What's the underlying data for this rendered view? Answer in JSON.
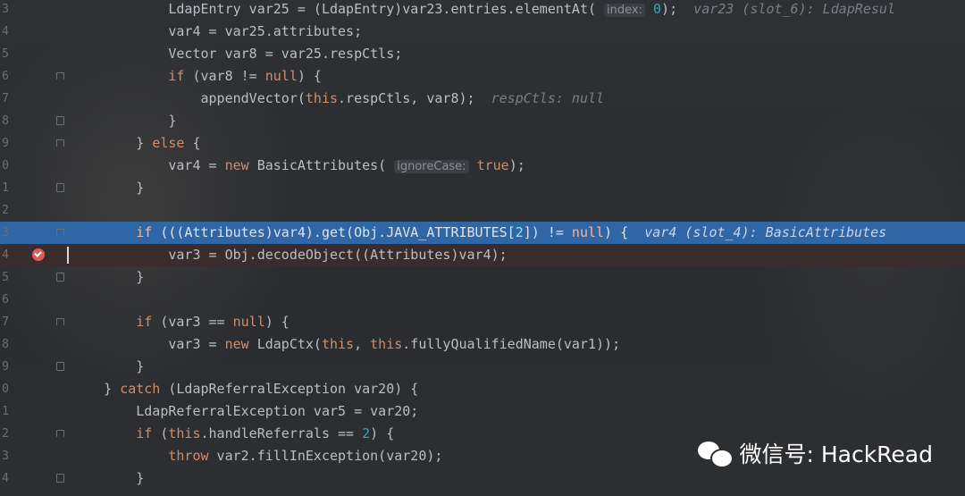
{
  "editor": {
    "lines": [
      {
        "num": "3",
        "tokens": [
          {
            "t": "            LdapEntry var25 = (LdapEntry)var23.entries.elementAt( "
          },
          {
            "t": "index:",
            "c": "hint"
          },
          {
            "t": " "
          },
          {
            "t": "0",
            "c": "num"
          },
          {
            "t": ");  "
          },
          {
            "t": "var23 (slot_6): LdapResul",
            "c": "inlineval"
          }
        ],
        "fold": false
      },
      {
        "num": "4",
        "tokens": [
          {
            "t": "            var4 = var25.attributes;"
          }
        ],
        "fold": false
      },
      {
        "num": "5",
        "tokens": [
          {
            "t": "            Vector var8 = var25.respCtls;"
          }
        ],
        "fold": false
      },
      {
        "num": "6",
        "tokens": [
          {
            "t": "            "
          },
          {
            "t": "if",
            "c": "kw"
          },
          {
            "t": " (var8 != "
          },
          {
            "t": "null",
            "c": "kw"
          },
          {
            "t": ") {"
          }
        ],
        "fold": "open"
      },
      {
        "num": "7",
        "tokens": [
          {
            "t": "                appendVector("
          },
          {
            "t": "this",
            "c": "kw"
          },
          {
            "t": ".respCtls, var8);  "
          },
          {
            "t": "respCtls: null",
            "c": "inlineval"
          }
        ],
        "fold": false
      },
      {
        "num": "8",
        "tokens": [
          {
            "t": "            }"
          }
        ],
        "fold": "close"
      },
      {
        "num": "9",
        "tokens": [
          {
            "t": "        } "
          },
          {
            "t": "else",
            "c": "kw"
          },
          {
            "t": " {"
          }
        ],
        "fold": "open"
      },
      {
        "num": "0",
        "tokens": [
          {
            "t": "            var4 = "
          },
          {
            "t": "new",
            "c": "kw"
          },
          {
            "t": " BasicAttributes( "
          },
          {
            "t": "ignoreCase:",
            "c": "hint"
          },
          {
            "t": " "
          },
          {
            "t": "true",
            "c": "kw"
          },
          {
            "t": ");"
          }
        ],
        "fold": false
      },
      {
        "num": "1",
        "tokens": [
          {
            "t": "        }"
          }
        ],
        "fold": "close"
      },
      {
        "num": "2",
        "tokens": [
          {
            "t": ""
          }
        ],
        "fold": false
      },
      {
        "num": "3",
        "tokens": [
          {
            "t": "        "
          },
          {
            "t": "if",
            "c": "kw"
          },
          {
            "t": " (((Attributes)var4).get(Obj.JAVA_ATTRIBUTES["
          },
          {
            "t": "2",
            "c": "num"
          },
          {
            "t": "]) != "
          },
          {
            "t": "null",
            "c": "kw"
          },
          {
            "t": ") {  "
          },
          {
            "t": "var4 (slot_4): BasicAttributes",
            "c": "inlineval"
          }
        ],
        "fold": "open",
        "state": "highlight"
      },
      {
        "num": "4",
        "tokens": [
          {
            "t": "            var3 = Obj.decodeObject((Attributes)var4);"
          }
        ],
        "fold": false,
        "state": "breakpoint"
      },
      {
        "num": "5",
        "tokens": [
          {
            "t": "        }"
          }
        ],
        "fold": "close"
      },
      {
        "num": "6",
        "tokens": [
          {
            "t": ""
          }
        ],
        "fold": false
      },
      {
        "num": "7",
        "tokens": [
          {
            "t": "        "
          },
          {
            "t": "if",
            "c": "kw"
          },
          {
            "t": " (var3 == "
          },
          {
            "t": "null",
            "c": "kw"
          },
          {
            "t": ") {"
          }
        ],
        "fold": "open"
      },
      {
        "num": "8",
        "tokens": [
          {
            "t": "            var3 = "
          },
          {
            "t": "new",
            "c": "kw"
          },
          {
            "t": " LdapCtx("
          },
          {
            "t": "this",
            "c": "kw"
          },
          {
            "t": ", "
          },
          {
            "t": "this",
            "c": "kw"
          },
          {
            "t": ".fullyQualifiedName(var1));"
          }
        ],
        "fold": false
      },
      {
        "num": "9",
        "tokens": [
          {
            "t": "        }"
          }
        ],
        "fold": "close"
      },
      {
        "num": "0",
        "tokens": [
          {
            "t": "    } "
          },
          {
            "t": "catch",
            "c": "kw"
          },
          {
            "t": " (LdapReferralException var20) {"
          }
        ],
        "fold": false
      },
      {
        "num": "1",
        "tokens": [
          {
            "t": "        LdapReferralException var5 = var20;"
          }
        ],
        "fold": false
      },
      {
        "num": "2",
        "tokens": [
          {
            "t": "        "
          },
          {
            "t": "if",
            "c": "kw"
          },
          {
            "t": " ("
          },
          {
            "t": "this",
            "c": "kw"
          },
          {
            "t": ".handleReferrals == "
          },
          {
            "t": "2",
            "c": "num"
          },
          {
            "t": ") {"
          }
        ],
        "fold": "open"
      },
      {
        "num": "3",
        "tokens": [
          {
            "t": "            "
          },
          {
            "t": "throw",
            "c": "kw"
          },
          {
            "t": " var2.fillInException(var20);"
          }
        ],
        "fold": false
      },
      {
        "num": "4",
        "tokens": [
          {
            "t": "        }"
          }
        ],
        "fold": "close"
      }
    ]
  },
  "watermark": {
    "text": "微信号: HackRead",
    "icon": "wechat-icon"
  },
  "colors": {
    "background": "#2b2d30",
    "keyword": "#cf8e6d",
    "number": "#2aacb8",
    "highlight": "#2f66a6",
    "breakpoint": "#db5c5c"
  }
}
